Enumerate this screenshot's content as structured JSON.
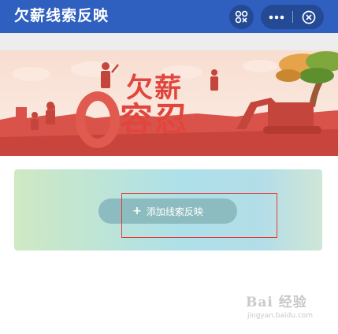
{
  "nav": {
    "title": "欠薪线索反映",
    "scan_icon": "scan-code-icon",
    "more_icon": "more-dots-icon",
    "close_icon": "close-circle-icon",
    "color": "#2f5fbf"
  },
  "banner": {
    "headline_top": "欠薪",
    "headline_zero": "0",
    "headline_bottom": "容忍"
  },
  "main": {
    "add_button_label": "添加线索反映",
    "add_button_icon": "plus-icon"
  },
  "watermark": {
    "text": "Bai 经验",
    "url": "jingyan.baidu.com"
  }
}
